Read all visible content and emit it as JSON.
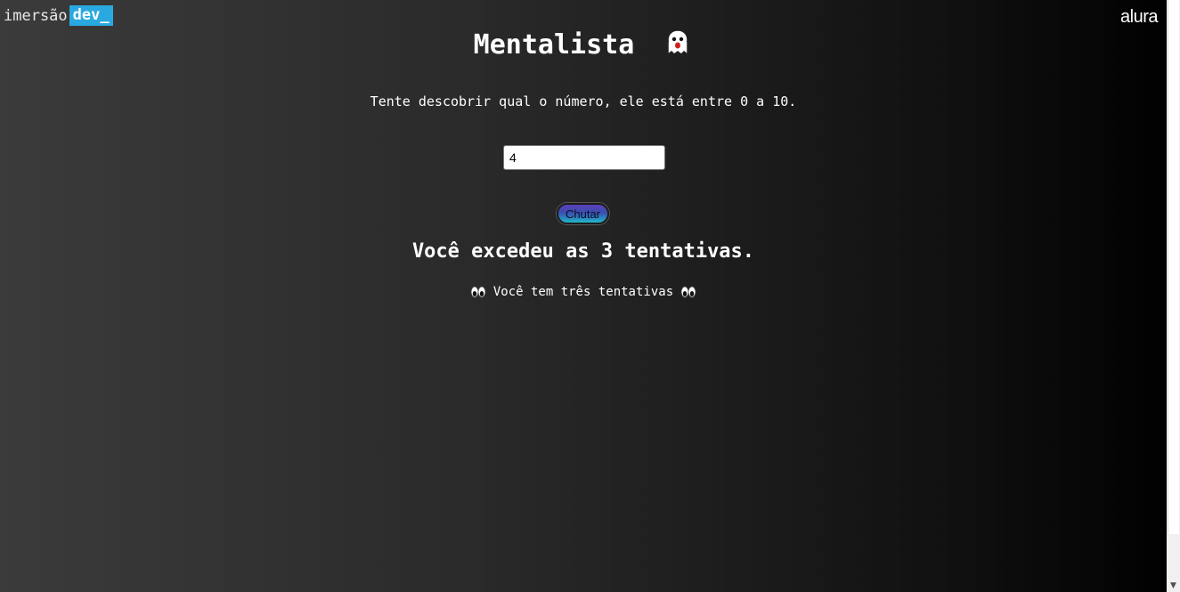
{
  "brand": {
    "left_prefix": "imersão",
    "left_suffix": "dev_",
    "right": "alura"
  },
  "page": {
    "title": "Mentalista",
    "title_icon": "ghost-icon",
    "subtitle": "Tente descobrir qual o número, ele está entre 0 a 10."
  },
  "form": {
    "input_value": "4",
    "button_label": "Chutar"
  },
  "result": {
    "message": "Você excedeu as 3 tentativas.",
    "hint": "Você tem três tentativas",
    "hint_icon": "eyes-icon"
  },
  "colors": {
    "dev_badge": "#2aa9e0",
    "button_top": "#5a3fb8",
    "button_bottom": "#1fb6c9"
  }
}
